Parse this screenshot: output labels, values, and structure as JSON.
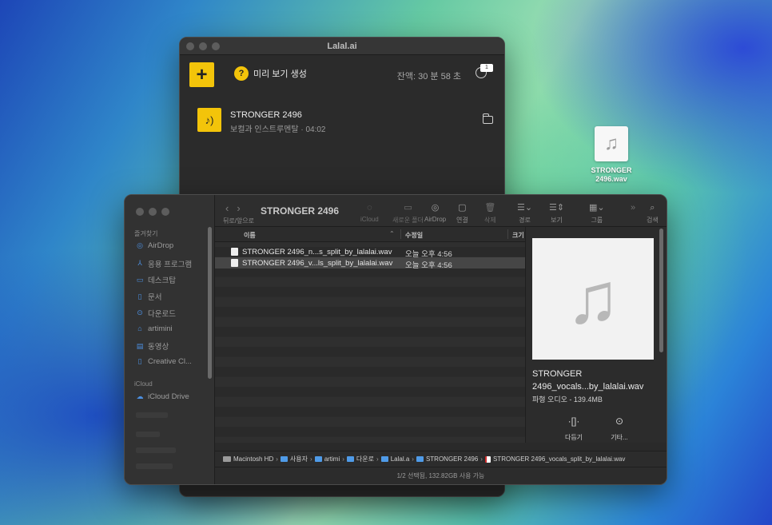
{
  "lalal": {
    "title": "Lalal.ai",
    "preview_label": "미리 보기 생성",
    "remaining": "잔액: 30 분 58 초",
    "badge": "1",
    "add_label": "+",
    "track": {
      "name": "STRONGER 2496",
      "meta": "보컬과 인스트루멘탈 · 04:02"
    }
  },
  "desktop_file": {
    "name": "STRONGER 2496.wav"
  },
  "finder": {
    "title": "STRONGER 2496",
    "nav_label": "뒤로/앞으로",
    "toolbar": [
      {
        "label": "iCloud",
        "icon": "◌"
      },
      {
        "label": "새로운 폴더",
        "icon": "▭"
      },
      {
        "label": "AirDrop",
        "icon": "◎"
      },
      {
        "label": "연결",
        "icon": "▢"
      },
      {
        "label": "삭제",
        "icon": "🗑"
      },
      {
        "label": "경로",
        "icon": "☰⌄"
      },
      {
        "label": "보기",
        "icon": "☰⇕"
      },
      {
        "label": "그룹",
        "icon": "▦⌄"
      },
      {
        "label": "검색",
        "icon": "⌕"
      }
    ],
    "more_icon": "»",
    "sidebar": {
      "favorites_header": "즐겨찾기",
      "favorites": [
        {
          "label": "AirDrop",
          "icon": "◎"
        },
        {
          "label": "응용 프로그램",
          "icon": "⅄"
        },
        {
          "label": "데스크탑",
          "icon": "▭"
        },
        {
          "label": "문서",
          "icon": "▯"
        },
        {
          "label": "다운로드",
          "icon": "⊙"
        },
        {
          "label": "artimini",
          "icon": "⌂"
        },
        {
          "label": "동영상",
          "icon": "▤"
        },
        {
          "label": "Creative Cl...",
          "icon": "▯"
        }
      ],
      "icloud_header": "iCloud",
      "icloud": [
        {
          "label": "iCloud Drive",
          "icon": "☁"
        }
      ]
    },
    "columns": {
      "name": "이름",
      "date": "수정일",
      "size": "크기"
    },
    "files": [
      {
        "name": "STRONGER 2496_n...s_split_by_lalalai.wav",
        "date": "오늘 오후 4:56"
      },
      {
        "name": "STRONGER 2496_v...ls_split_by_lalalai.wav",
        "date": "오늘 오후 4:56"
      }
    ],
    "preview": {
      "name": "STRONGER 2496_vocals...by_lalalai.wav",
      "meta": "파형 오디오 - 139.4MB",
      "actions": [
        {
          "label": "다듬기",
          "icon": "·[]·"
        },
        {
          "label": "기타...",
          "icon": "⊙"
        }
      ]
    },
    "path": [
      {
        "label": "Macintosh HD",
        "kind": "hd"
      },
      {
        "label": "사용자",
        "kind": "folder"
      },
      {
        "label": "artimi",
        "kind": "folder"
      },
      {
        "label": "다운로",
        "kind": "folder"
      },
      {
        "label": "Lalal.a",
        "kind": "folder"
      },
      {
        "label": "STRONGER 2496",
        "kind": "folder"
      },
      {
        "label": "STRONGER 2496_vocals_split_by_lalalai.wav",
        "kind": "wav"
      }
    ],
    "status": "1/2 선택됨, 132.82GB 사용 가능"
  }
}
